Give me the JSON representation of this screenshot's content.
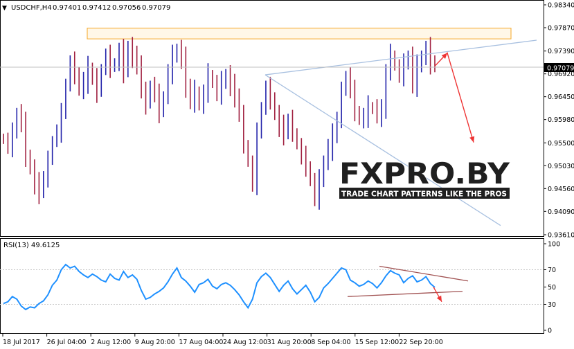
{
  "header": {
    "menu_glyph": "▼",
    "symbol": "USDCHF,H4",
    "ohlc": [
      "0.97401",
      "0.97412",
      "0.97056",
      "0.97079"
    ]
  },
  "rsi_header": {
    "label": "RSI(13) 49.6125"
  },
  "watermark": {
    "brand": "FXPRO.BY",
    "tagline": "TRADE CHART PATTERNS LIKE THE PROS"
  },
  "colors": {
    "bull_candle": "#2222aa",
    "bear_candle": "#a02040",
    "rsi_line": "#1e90ff",
    "trendline": "#a8c0e0",
    "resistance_zone": "#f5a623",
    "forecast_arrow": "#ee3333",
    "rsi_pattern": "#a05050",
    "price_marker": "#000000",
    "watermark_red": "#cc1f1f",
    "watermark_dark": "#1f1f1f"
  },
  "chart_data": [
    {
      "type": "candlestick",
      "title": "USDCHF,H4",
      "timeframe": "H4",
      "open": 0.97401,
      "high": 0.97412,
      "low": 0.97056,
      "close": 0.97079,
      "current_price": 0.97079,
      "ylim": [
        0.9361,
        0.9834
      ],
      "yticks": [
        "0.98340",
        "0.97870",
        "0.97390",
        "0.96920",
        "0.96450",
        "0.95980",
        "0.95500",
        "0.95030",
        "0.94560",
        "0.94090",
        "0.93610"
      ],
      "current_price_label": "0.97079",
      "xticks": [
        "18 Jul 2017",
        "26 Jul 04:00",
        "2 Aug 12:00",
        "9 Aug 20:00",
        "17 Aug 04:00",
        "24 Aug 12:00",
        "31 Aug 20:00",
        "8 Sep 04:00",
        "15 Sep 12:00",
        "22 Sep 20:00"
      ],
      "closes": [
        0.9555,
        0.9542,
        0.9568,
        0.9612,
        0.9588,
        0.9524,
        0.9496,
        0.9462,
        0.9449,
        0.9478,
        0.9512,
        0.9556,
        0.9572,
        0.9608,
        0.9672,
        0.9712,
        0.9694,
        0.9658,
        0.9676,
        0.9701,
        0.9682,
        0.9652,
        0.9704,
        0.9728,
        0.9705,
        0.9714,
        0.9738,
        0.9696,
        0.9748,
        0.9722,
        0.9716,
        0.9654,
        0.9628,
        0.967,
        0.9648,
        0.9612,
        0.9646,
        0.9694,
        0.9726,
        0.9742,
        0.972,
        0.9668,
        0.9632,
        0.9658,
        0.9624,
        0.9654,
        0.969,
        0.9672,
        0.9652,
        0.9672,
        0.969,
        0.9664,
        0.9648,
        0.9606,
        0.9548,
        0.9508,
        0.9464,
        0.9568,
        0.9624,
        0.966,
        0.9642,
        0.9608,
        0.958,
        0.957,
        0.9596,
        0.9572,
        0.9544,
        0.952,
        0.9502,
        0.947,
        0.9436,
        0.947,
        0.9512,
        0.9538,
        0.9562,
        0.96,
        0.9654,
        0.969,
        0.9656,
        0.9616,
        0.9596,
        0.9604,
        0.9622,
        0.962,
        0.9608,
        0.9612,
        0.9698,
        0.9732,
        0.9706,
        0.9688,
        0.971,
        0.973,
        0.9668,
        0.9706,
        0.9728,
        0.974,
        0.9716,
        0.9708
      ],
      "annotations": [
        {
          "kind": "resistance_zone",
          "from": 0.9764,
          "to": 0.9786
        },
        {
          "kind": "rising_trendline",
          "from": [
            0.969,
            0.9727
          ],
          "to": [
            null,
            null
          ]
        },
        {
          "kind": "falling_trendline",
          "from": 0.969,
          "to": 0.938
        },
        {
          "kind": "forecast_arrow",
          "path": [
            0.9708,
            0.9735,
            0.9551
          ]
        }
      ]
    },
    {
      "type": "line",
      "title": "RSI(13) 49.6125",
      "indicator": "RSI",
      "period": 13,
      "last_value": 49.6125,
      "ylim": [
        0,
        100
      ],
      "yticks": [
        "100",
        "70",
        "50",
        "30",
        "0"
      ],
      "values": [
        31,
        33,
        39,
        36,
        28,
        24,
        27,
        26,
        31,
        34,
        41,
        52,
        58,
        70,
        76,
        72,
        74,
        68,
        64,
        61,
        65,
        62,
        58,
        56,
        65,
        60,
        58,
        68,
        61,
        64,
        59,
        46,
        36,
        38,
        42,
        45,
        49,
        56,
        65,
        72,
        61,
        57,
        51,
        44,
        53,
        55,
        59,
        51,
        48,
        53,
        55,
        52,
        47,
        41,
        33,
        26,
        36,
        55,
        62,
        66,
        61,
        53,
        45,
        52,
        57,
        48,
        42,
        47,
        52,
        44,
        33,
        38,
        49,
        54,
        60,
        66,
        72,
        70,
        58,
        55,
        51,
        53,
        57,
        54,
        49,
        55,
        63,
        69,
        66,
        64,
        55,
        60,
        63,
        56,
        58,
        62,
        54,
        49.6
      ],
      "annotations": [
        {
          "kind": "upper_line",
          "from": 74,
          "to": 57
        },
        {
          "kind": "lower_line",
          "from": 39,
          "to": 45
        },
        {
          "kind": "forecast_arrow"
        }
      ]
    }
  ]
}
